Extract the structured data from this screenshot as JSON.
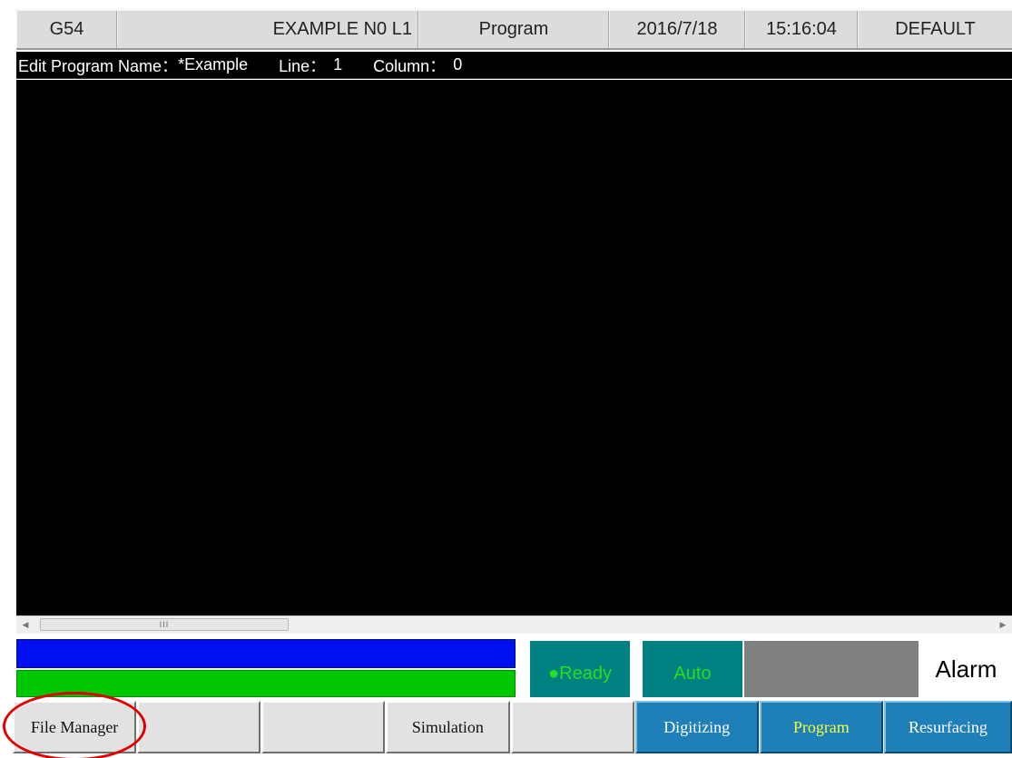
{
  "header": {
    "coord_system": "G54",
    "program_line": "EXAMPLE N0 L1",
    "mode": "Program",
    "date": "2016/7/18",
    "time": "15:16:04",
    "profile": "DEFAULT"
  },
  "info": {
    "program_name_label": "Edit Program Name：",
    "program_name": "*Example",
    "line_label": "Line：",
    "line": "1",
    "column_label": "Column：",
    "column": "0"
  },
  "scrollbar": {
    "thumb_grip": "III",
    "left_arrow": "◀",
    "right_arrow": "▶"
  },
  "status": {
    "ready": "●Ready",
    "auto": "Auto",
    "alarm": "Alarm"
  },
  "function_keys": {
    "file_manager": "File Manager",
    "simulation": "Simulation",
    "digitizing": "Digitizing",
    "program": "Program",
    "resurfacing": "Resurfacing"
  },
  "colors": {
    "editor_bg": "#000000",
    "feed_bar_blue": "#0010f0",
    "spindle_bar_green": "#00c800",
    "status_teal": "#008080",
    "status_text_green": "#22e022",
    "function_key_blue": "#1f7fb8",
    "active_key_text": "#f0ff40",
    "highlight_red": "#e00000"
  }
}
